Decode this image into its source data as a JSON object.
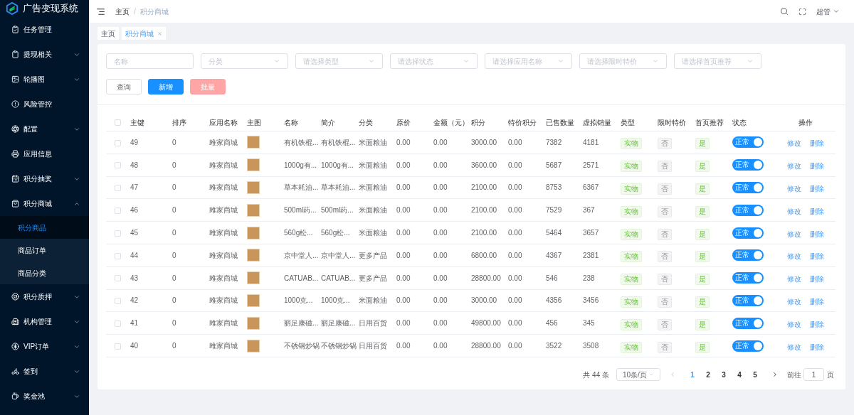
{
  "app": {
    "title": "广告变现系统"
  },
  "sidebar": {
    "items": [
      {
        "label": "任务管理"
      },
      {
        "label": "提现相关",
        "expanded": false
      },
      {
        "label": "轮播图",
        "expanded": false
      },
      {
        "label": "风险管控"
      },
      {
        "label": "配置",
        "expanded": false
      },
      {
        "label": "应用信息"
      },
      {
        "label": "积分抽奖",
        "expanded": false
      },
      {
        "label": "积分商城",
        "expanded": true,
        "children": [
          {
            "label": "积分商品",
            "selected": true
          },
          {
            "label": "商品订单",
            "selected": false
          },
          {
            "label": "商品分类",
            "selected": false
          }
        ]
      },
      {
        "label": "积分质押",
        "expanded": false
      },
      {
        "label": "机构管理",
        "expanded": false
      },
      {
        "label": "VIP订单",
        "expanded": false
      },
      {
        "label": "签到",
        "expanded": false
      },
      {
        "label": "奖金池",
        "expanded": false
      }
    ]
  },
  "header": {
    "breadcrumb": [
      "主页",
      "积分商城"
    ],
    "separator": "/",
    "user": "超管"
  },
  "tabs": [
    {
      "label": "主页",
      "selected": false,
      "closable": false
    },
    {
      "label": "积分商城",
      "selected": true,
      "closable": true
    }
  ],
  "filters": [
    {
      "kind": "input",
      "placeholder": "名称"
    },
    {
      "kind": "select",
      "placeholder": "分类"
    },
    {
      "kind": "select",
      "placeholder": "请选择类型"
    },
    {
      "kind": "select",
      "placeholder": "请选择状态"
    },
    {
      "kind": "select",
      "placeholder": "请选择应用名称"
    },
    {
      "kind": "select",
      "placeholder": "请选择限时特价"
    },
    {
      "kind": "select",
      "placeholder": "请选择首页推荐"
    }
  ],
  "buttons": [
    {
      "label": "查询",
      "kind": "default",
      "disabled": false
    },
    {
      "label": "新增",
      "kind": "primary",
      "disabled": false
    },
    {
      "label": "批量",
      "kind": "danger",
      "disabled": true
    }
  ],
  "table": {
    "all_checked": false,
    "columns": [
      "主键",
      "排序",
      "应用名称",
      "主图",
      "名称",
      "简介",
      "分类",
      "原价",
      "金额（元）",
      "积分",
      "特价积分",
      "已售数量",
      "虚拟销量",
      "类型",
      "限时特价",
      "首页推荐",
      "状态",
      "操作"
    ],
    "rows": [
      {
        "checked": false,
        "id": "49",
        "sort": "0",
        "app": "雎家商城",
        "name": "有机铁棍...",
        "intro": "有机铁棍...",
        "category": "米面粮油",
        "price": "0.00",
        "amount": "0.00",
        "points": "3000.00",
        "special": "0.00",
        "sold": "7382",
        "virtual": "4181",
        "type": "实物",
        "limited": {
          "label": "否",
          "active": false
        },
        "home": {
          "label": "是",
          "active": true
        },
        "status": {
          "label": "正常",
          "on": true
        },
        "actions": [
          "修改",
          "删除"
        ]
      },
      {
        "checked": false,
        "id": "48",
        "sort": "0",
        "app": "雎家商城",
        "name": "1000g有...",
        "intro": "1000g有...",
        "category": "米面粮油",
        "price": "0.00",
        "amount": "0.00",
        "points": "3600.00",
        "special": "0.00",
        "sold": "5687",
        "virtual": "2571",
        "type": "实物",
        "limited": {
          "label": "否",
          "active": false
        },
        "home": {
          "label": "是",
          "active": true
        },
        "status": {
          "label": "正常",
          "on": true
        },
        "actions": [
          "修改",
          "删除"
        ]
      },
      {
        "checked": false,
        "id": "47",
        "sort": "0",
        "app": "雎家商城",
        "name": "草本耗油...",
        "intro": "草本耗油...",
        "category": "米面粮油",
        "price": "0.00",
        "amount": "0.00",
        "points": "2100.00",
        "special": "0.00",
        "sold": "8753",
        "virtual": "6367",
        "type": "实物",
        "limited": {
          "label": "否",
          "active": false
        },
        "home": {
          "label": "是",
          "active": true
        },
        "status": {
          "label": "正常",
          "on": true
        },
        "actions": [
          "修改",
          "删除"
        ]
      },
      {
        "checked": false,
        "id": "46",
        "sort": "0",
        "app": "雎家商城",
        "name": "500ml药...",
        "intro": "500ml药...",
        "category": "米面粮油",
        "price": "0.00",
        "amount": "0.00",
        "points": "2100.00",
        "special": "0.00",
        "sold": "7529",
        "virtual": "367",
        "type": "实物",
        "limited": {
          "label": "否",
          "active": false
        },
        "home": {
          "label": "是",
          "active": true
        },
        "status": {
          "label": "正常",
          "on": true
        },
        "actions": [
          "修改",
          "删除"
        ]
      },
      {
        "checked": false,
        "id": "45",
        "sort": "0",
        "app": "雎家商城",
        "name": "560g松...",
        "intro": "560g松...",
        "category": "米面粮油",
        "price": "0.00",
        "amount": "0.00",
        "points": "2100.00",
        "special": "0.00",
        "sold": "5464",
        "virtual": "3657",
        "type": "实物",
        "limited": {
          "label": "否",
          "active": false
        },
        "home": {
          "label": "是",
          "active": true
        },
        "status": {
          "label": "正常",
          "on": true
        },
        "actions": [
          "修改",
          "删除"
        ]
      },
      {
        "checked": false,
        "id": "44",
        "sort": "0",
        "app": "雎家商城",
        "name": "京中堂人...",
        "intro": "京中堂人...",
        "category": "更多产品",
        "price": "0.00",
        "amount": "0.00",
        "points": "6800.00",
        "special": "0.00",
        "sold": "4367",
        "virtual": "2381",
        "type": "实物",
        "limited": {
          "label": "否",
          "active": false
        },
        "home": {
          "label": "是",
          "active": true
        },
        "status": {
          "label": "正常",
          "on": true
        },
        "actions": [
          "修改",
          "删除"
        ]
      },
      {
        "checked": false,
        "id": "43",
        "sort": "0",
        "app": "雎家商城",
        "name": "CATUAB...",
        "intro": "CATUAB...",
        "category": "更多产品",
        "price": "0.00",
        "amount": "0.00",
        "points": "28800.00",
        "special": "0.00",
        "sold": "546",
        "virtual": "238",
        "type": "实物",
        "limited": {
          "label": "否",
          "active": false
        },
        "home": {
          "label": "是",
          "active": true
        },
        "status": {
          "label": "正常",
          "on": true
        },
        "actions": [
          "修改",
          "删除"
        ]
      },
      {
        "checked": false,
        "id": "42",
        "sort": "0",
        "app": "雎家商城",
        "name": "1000克...",
        "intro": "1000克...",
        "category": "米面粮油",
        "price": "0.00",
        "amount": "0.00",
        "points": "3000.00",
        "special": "0.00",
        "sold": "4356",
        "virtual": "3456",
        "type": "实物",
        "limited": {
          "label": "否",
          "active": false
        },
        "home": {
          "label": "是",
          "active": true
        },
        "status": {
          "label": "正常",
          "on": true
        },
        "actions": [
          "修改",
          "删除"
        ]
      },
      {
        "checked": false,
        "id": "41",
        "sort": "0",
        "app": "雎家商城",
        "name": "丽足康磁...",
        "intro": "丽足康磁...",
        "category": "日用百货",
        "price": "0.00",
        "amount": "0.00",
        "points": "49800.00",
        "special": "0.00",
        "sold": "456",
        "virtual": "345",
        "type": "实物",
        "limited": {
          "label": "否",
          "active": false
        },
        "home": {
          "label": "是",
          "active": true
        },
        "status": {
          "label": "正常",
          "on": true
        },
        "actions": [
          "修改",
          "删除"
        ]
      },
      {
        "checked": false,
        "id": "40",
        "sort": "0",
        "app": "雎家商城",
        "name": "不锈钢炒锅",
        "intro": "不锈钢炒锅",
        "category": "日用百货",
        "price": "0.00",
        "amount": "0.00",
        "points": "28800.00",
        "special": "0.00",
        "sold": "3522",
        "virtual": "3508",
        "type": "实物",
        "limited": {
          "label": "否",
          "active": false
        },
        "home": {
          "label": "是",
          "active": true
        },
        "status": {
          "label": "正常",
          "on": true
        },
        "actions": [
          "修改",
          "删除"
        ]
      }
    ]
  },
  "pagination": {
    "total": "共 44 条",
    "page_size": "10条/页",
    "pages": [
      {
        "label": "1",
        "selected": true
      },
      {
        "label": "2",
        "selected": false
      },
      {
        "label": "3",
        "selected": false
      },
      {
        "label": "4",
        "selected": false
      },
      {
        "label": "5",
        "selected": false
      }
    ],
    "goto_label": "前往",
    "goto_value": "1",
    "goto_suffix": "页"
  }
}
